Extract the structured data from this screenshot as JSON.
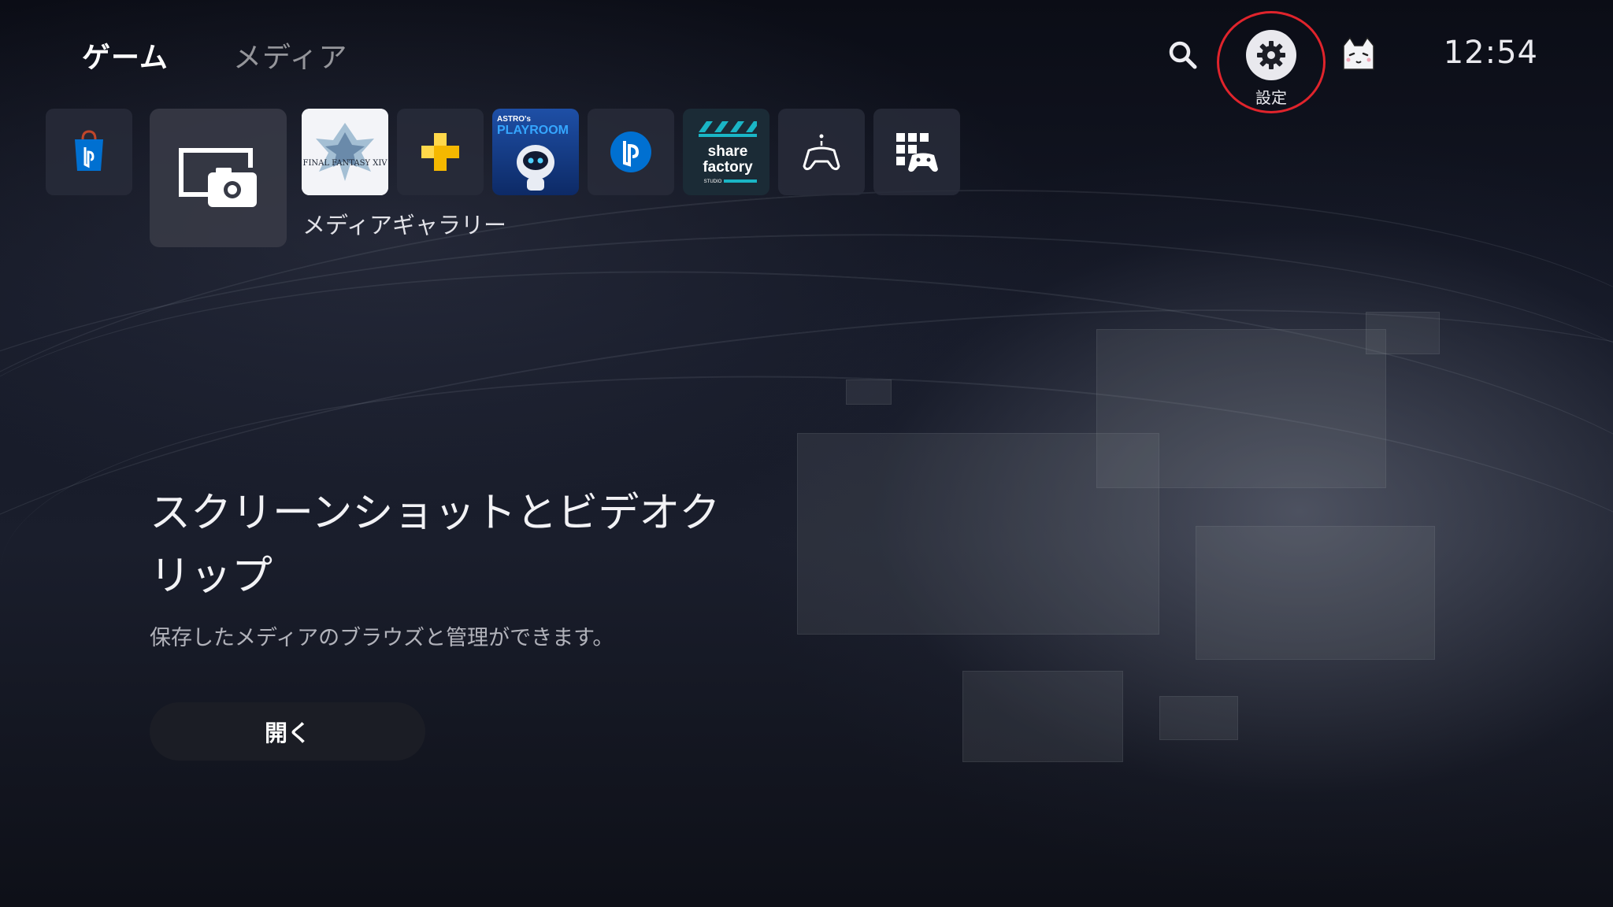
{
  "top_nav": {
    "tabs": [
      {
        "label": "ゲーム",
        "active": true
      },
      {
        "label": "メディア",
        "active": false
      }
    ],
    "settings_label": "設定",
    "clock": "12:54"
  },
  "launcher": {
    "tiles": [
      {
        "name": "PlayStation Store",
        "icon": "ps-store-icon"
      },
      {
        "name": "メディアギャラリー",
        "icon": "media-gallery-icon",
        "focused": true
      },
      {
        "name": "FINAL FANTASY XIV",
        "icon": "ffxiv-icon",
        "art_text": "FINAL FANTASY XIV"
      },
      {
        "name": "PlayStation Plus",
        "icon": "ps-plus-icon"
      },
      {
        "name": "ASTRO's PLAYROOM",
        "icon": "astro-playroom-icon",
        "art_text_1": "ASTRO's",
        "art_text_2": "PLAYROOM"
      },
      {
        "name": "PlayStation",
        "icon": "playstation-icon"
      },
      {
        "name": "Share Factory Studio",
        "icon": "share-factory-icon",
        "art_text_1": "share",
        "art_text_2": "factory",
        "art_text_3": "STUDIO"
      },
      {
        "name": "Remote Play",
        "icon": "controller-icon"
      },
      {
        "name": "ゲームライブラリー",
        "icon": "game-library-icon"
      }
    ],
    "focused_label": "メディアギャラリー"
  },
  "feature": {
    "title_line1": "スクリーンショットとビデオク",
    "title_line2": "リップ",
    "description": "保存したメディアのブラウズと管理ができます。",
    "open_button": "開く"
  },
  "colors": {
    "highlight_ring": "#e0242c",
    "ps_blue": "#0070d1",
    "ps_plus_yellow": "#f5b800",
    "share_factory_teal": "#1ab5c5"
  }
}
